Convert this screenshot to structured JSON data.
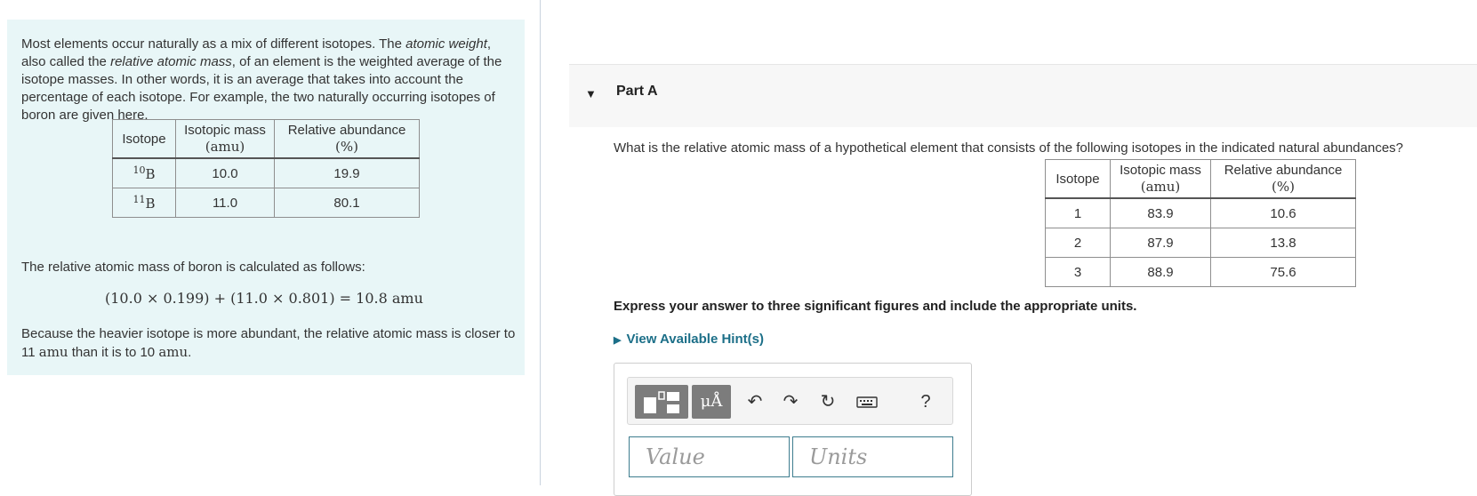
{
  "intro": {
    "p1_a": "Most elements occur naturally as a mix of different isotopes. The ",
    "p1_em1": "atomic weight",
    "p1_b": ", also called the ",
    "p1_em2": "relative atomic mass",
    "p1_c": ", of an element is the weighted average of the isotope masses. In other words, it is an average that takes into account the percentage of each isotope. For example, the two naturally occurring isotopes of boron are given here.",
    "table": {
      "headers": {
        "isotope": "Isotope",
        "mass": "Isotopic mass",
        "mass_unit": "(amu)",
        "abundance": "Relative abundance",
        "abundance_unit": "(%)"
      },
      "rows": [
        {
          "mass_number": "10",
          "symbol": "B",
          "mass": "10.0",
          "abundance": "19.9"
        },
        {
          "mass_number": "11",
          "symbol": "B",
          "mass": "11.0",
          "abundance": "80.1"
        }
      ]
    },
    "calc_text": "The relative atomic mass of boron is calculated as follows:",
    "equation": "(10.0 × 0.199) + (11.0 × 0.801) = 10.8 amu",
    "concl_a": "Because the heavier isotope is more abundant, the relative atomic mass is closer to 11 ",
    "concl_unit1": "amu",
    "concl_b": " than it is to 10 ",
    "concl_unit2": "amu",
    "concl_c": "."
  },
  "part": {
    "title": "Part A",
    "question": "What is the relative atomic mass of a hypothetical element that consists of the following isotopes in the indicated natural abundances?",
    "table": {
      "headers": {
        "isotope": "Isotope",
        "mass": "Isotopic mass",
        "mass_unit": "(amu)",
        "abundance": "Relative abundance",
        "abundance_unit": "(%)"
      },
      "rows": [
        {
          "isotope": "1",
          "mass": "83.9",
          "abundance": "10.6"
        },
        {
          "isotope": "2",
          "mass": "87.9",
          "abundance": "13.8"
        },
        {
          "isotope": "3",
          "mass": "88.9",
          "abundance": "75.6"
        }
      ]
    },
    "instruction": "Express your answer to three significant figures and include the appropriate units.",
    "hint_label": "View Available Hint(s)",
    "toolbar": {
      "symbols_label": "μÅ",
      "help_label": "?"
    },
    "value_placeholder": "Value",
    "units_placeholder": "Units"
  }
}
